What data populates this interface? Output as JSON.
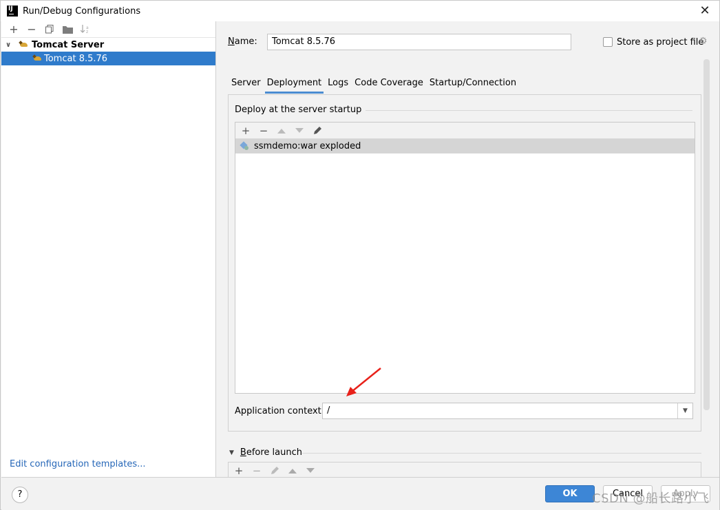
{
  "window": {
    "title": "Run/Debug Configurations",
    "app_icon_label": "IJ"
  },
  "left_panel": {
    "toolbar": [
      "add-icon",
      "remove-icon",
      "copy-icon",
      "folder-icon",
      "sort-icon"
    ],
    "tree": {
      "group_label": "Tomcat Server",
      "child_label": "Tomcat 8.5.76"
    },
    "edit_templates_link": "Edit configuration templates..."
  },
  "config": {
    "name_label": "Name:",
    "name_value": "Tomcat 8.5.76",
    "store_label": "Store as project file",
    "store_checked": false,
    "tabs": [
      "Server",
      "Deployment",
      "Logs",
      "Code Coverage",
      "Startup/Connection"
    ],
    "active_tab": "Deployment",
    "deploy_section_title": "Deploy at the server startup",
    "deploy_items": [
      "ssmdemo:war exploded"
    ],
    "app_context_label": "Application context:",
    "app_context_value": "/",
    "before_launch_label": "Before launch"
  },
  "buttons": {
    "help": "?",
    "ok": "OK",
    "cancel": "Cancel",
    "apply": "Apply"
  },
  "watermark": "CSDN @船长路小飞",
  "colors": {
    "selection": "#2f7bcb",
    "primary_button": "#3d86d6",
    "link": "#2667b8",
    "annotation_arrow": "#e8211a"
  }
}
